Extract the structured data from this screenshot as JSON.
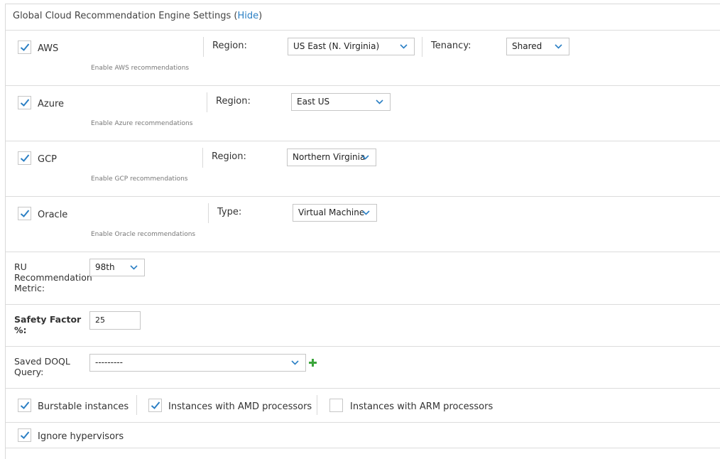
{
  "header": {
    "title": "Global Cloud Recommendation Engine Settings",
    "open_paren": "(",
    "hide_link": "Hide",
    "close_paren": ")"
  },
  "providers": [
    {
      "name": "AWS",
      "checked": true,
      "sub": "Enable AWS recommendations",
      "region_label": "Region:",
      "region_value": "US East (N. Virginia)",
      "tenancy_label": "Tenancy:",
      "tenancy_value": "Shared"
    },
    {
      "name": "Azure",
      "checked": true,
      "sub": "Enable Azure recommendations",
      "region_label": "Region:",
      "region_value": "East US"
    },
    {
      "name": "GCP",
      "checked": true,
      "sub": "Enable GCP recommendations",
      "region_label": "Region:",
      "region_value": "Northern Virginia"
    },
    {
      "name": "Oracle",
      "checked": true,
      "sub": "Enable Oracle recommendations",
      "type_label": "Type:",
      "type_value": "Virtual Machine"
    }
  ],
  "ru_metric": {
    "label_1": "RU",
    "label_2": "Recommendation",
    "label_3": "Metric:",
    "value": "98th"
  },
  "safety_factor": {
    "label_1": "Safety Factor",
    "label_2": "%:",
    "value": "25"
  },
  "doql": {
    "label_1": "Saved DOQL",
    "label_2": "Query:",
    "value": "---------"
  },
  "options": [
    {
      "label": "Burstable instances",
      "checked": true
    },
    {
      "label": "Instances with AMD processors",
      "checked": true
    },
    {
      "label": "Instances with ARM processors",
      "checked": false
    },
    {
      "label": "Ignore hypervisors",
      "checked": true
    }
  ],
  "colors": {
    "accent": "#2a7fc4",
    "check": "#2a7fc4",
    "plus": "#3aa53a",
    "border": "#d9d9d9"
  }
}
